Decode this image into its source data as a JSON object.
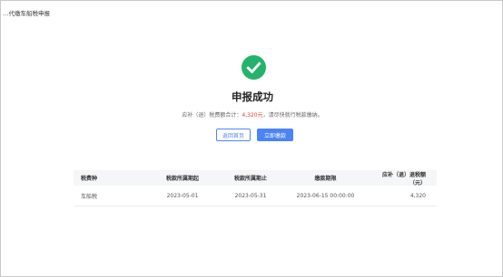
{
  "app": {
    "title": "…代缴车船税申报"
  },
  "result": {
    "headline": "申报成功",
    "summary_prefix": "应补（退）税费额合计：",
    "summary_amount": "4,320元",
    "summary_suffix": "，请尽快就行税款缴纳。",
    "icon": "check-circle-icon",
    "icon_color": "#25b36b"
  },
  "actions": {
    "home_label": "返回首页",
    "pay_label": "立即缴款",
    "accent_color": "#4a84f6"
  },
  "table": {
    "headers": [
      "税费种",
      "税款所属期起",
      "税款所属期止",
      "缴款期限",
      "应补（退）退税额（元）"
    ],
    "rows": [
      [
        "车船税",
        "2023-05-01",
        "2023-05-31",
        "2023-06-15 00:00:00",
        "4,320"
      ]
    ]
  }
}
